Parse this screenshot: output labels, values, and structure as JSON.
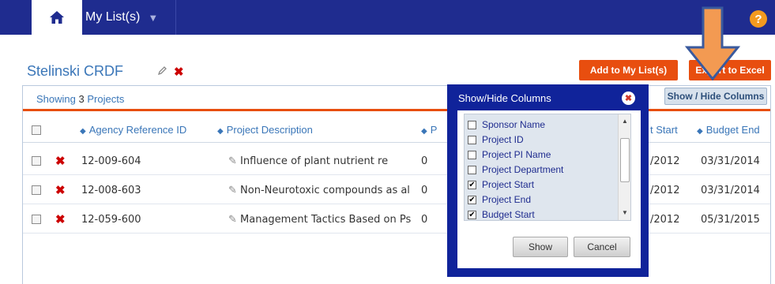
{
  "nav": {
    "home_icon": "home-icon",
    "my_lists": "My List(s)",
    "caret": "▼",
    "help": "?"
  },
  "header": {
    "title": "Stelinski CRDF",
    "add_to_list": "Add to My List(s)",
    "export_excel": "Export to Excel"
  },
  "panel": {
    "showing_prefix": "Showing",
    "showing_count": "3",
    "showing_suffix": "Projects",
    "show_hide_button": "Show / Hide Columns"
  },
  "table": {
    "headers": {
      "agency_ref": "Agency Reference ID",
      "description": "Project Description",
      "pi": "P",
      "budget_start": "t Start",
      "budget_end": "Budget End"
    },
    "rows": [
      {
        "ref": "12-009-604",
        "desc": "Influence of plant nutrient re",
        "c": "0",
        "start": "/2012",
        "end": "03/31/2014"
      },
      {
        "ref": "12-008-603",
        "desc": "Non-Neurotoxic compounds as al",
        "c": "0",
        "start": "/2012",
        "end": "03/31/2014"
      },
      {
        "ref": "12-059-600",
        "desc": "Management Tactics Based on Ps",
        "c": "0",
        "start": "/2012",
        "end": "05/31/2015"
      }
    ]
  },
  "popup": {
    "title": "Show/Hide Columns",
    "options": [
      {
        "label": "Sponsor Name",
        "checked": false
      },
      {
        "label": "Project ID",
        "checked": false
      },
      {
        "label": "Project PI Name",
        "checked": false
      },
      {
        "label": "Project Department",
        "checked": false
      },
      {
        "label": "Project Start",
        "checked": true
      },
      {
        "label": "Project End",
        "checked": true
      },
      {
        "label": "Budget Start",
        "checked": true
      }
    ],
    "show": "Show",
    "cancel": "Cancel"
  },
  "colors": {
    "nav_blue": "#1f2c8f",
    "accent_orange": "#e84e0f",
    "link_blue": "#3a76b8",
    "popup_blue": "#10239a",
    "annotation_arrow": "#f39a52"
  }
}
